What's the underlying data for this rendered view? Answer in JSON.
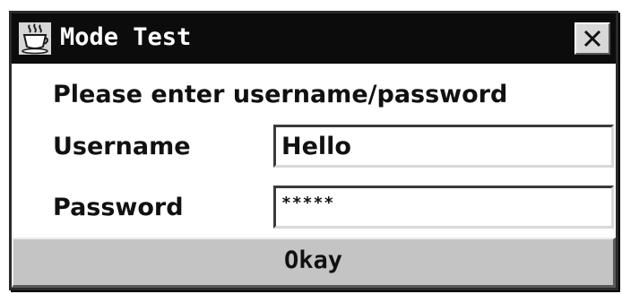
{
  "window": {
    "title": "Mode Test",
    "app_icon": "java-coffee-cup-icon",
    "close_icon": "close-x-icon"
  },
  "form": {
    "prompt": "Please enter username/password",
    "username_label": "Username",
    "username_value": "Hello",
    "password_label": "Password",
    "password_value": "*****"
  },
  "actions": {
    "okay_label": "Okay"
  },
  "colors": {
    "titlebar": "#0c0c0c",
    "title_text": "#ffffff",
    "button_face": "#c4c4c4",
    "window_background": "#ffffff"
  }
}
